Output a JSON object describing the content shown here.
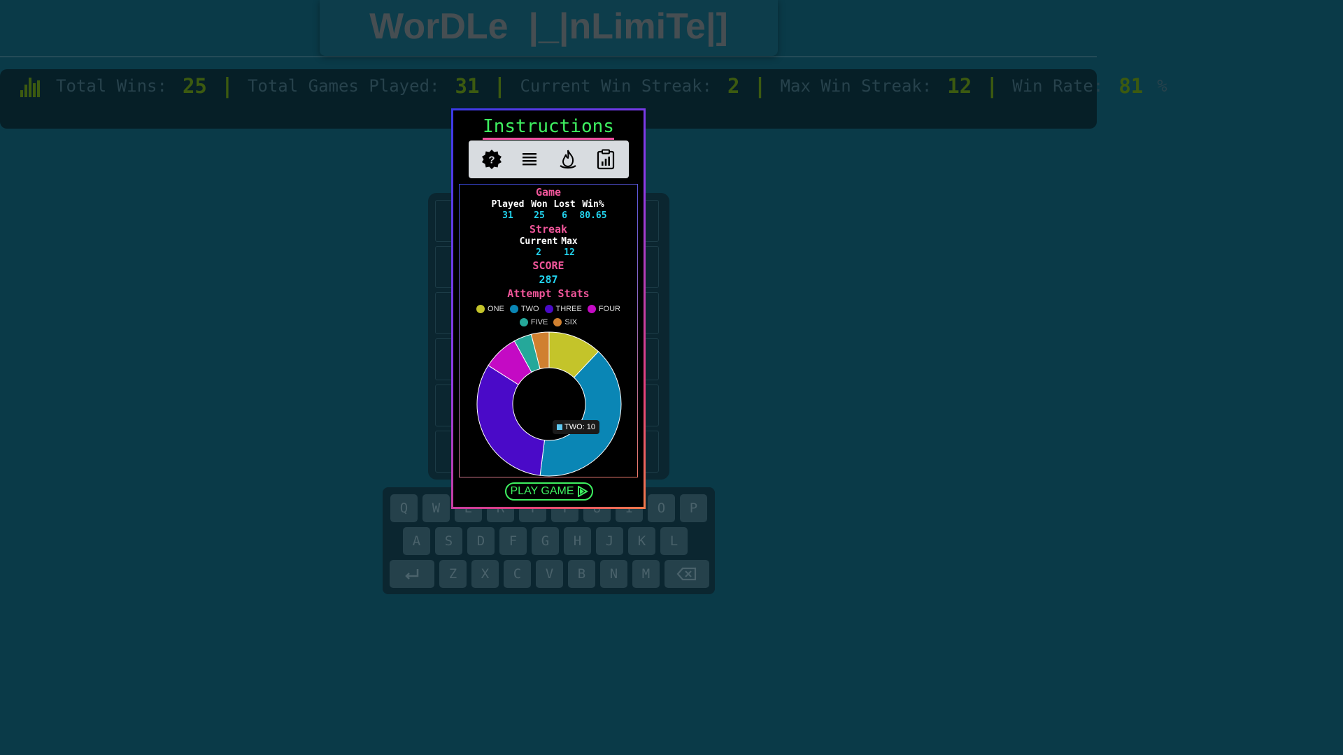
{
  "header": {
    "title": "WorDLe  |_|nLimiTe|]"
  },
  "stats_bar": {
    "icon": "bar-chart-icon",
    "total_wins_label": "Total Wins:",
    "total_wins": "25",
    "games_played_label": "Total Games Played:",
    "games_played": "31",
    "current_streak_label": "Current Win Streak:",
    "current_streak": "2",
    "max_streak_label": "Max Win Streak:",
    "max_streak": "12",
    "win_rate_label": "Win Rate:",
    "win_rate": "81",
    "win_rate_unit": "%",
    "separator": "|"
  },
  "keyboard": {
    "row1": [
      "Q",
      "W",
      "E",
      "R",
      "T",
      "Y",
      "U",
      "I",
      "O",
      "P"
    ],
    "row2": [
      "A",
      "S",
      "D",
      "F",
      "G",
      "H",
      "J",
      "K",
      "L"
    ],
    "row3": [
      "Z",
      "X",
      "C",
      "V",
      "B",
      "N",
      "M"
    ],
    "enter_icon": "enter-icon",
    "backspace_icon": "backspace-icon"
  },
  "modal": {
    "title": "Instructions",
    "tabs": [
      "help-icon",
      "list-icon",
      "flame-icon",
      "clipboard-chart-icon"
    ],
    "game_heading": "Game",
    "game_headers": [
      "Played",
      "Won",
      "Lost",
      "Win%"
    ],
    "game_values": [
      "31",
      "25",
      "6",
      "80.65"
    ],
    "streak_heading": "Streak",
    "streak_headers": [
      "Current",
      "Max"
    ],
    "streak_values": [
      "2",
      "12"
    ],
    "score_heading": "SCORE",
    "score_value": "287",
    "attempt_heading": "Attempt Stats",
    "play_button": "PLAY GAME",
    "tooltip": "TWO: 10"
  },
  "chart_data": {
    "type": "pie",
    "variant": "doughnut",
    "categories": [
      "ONE",
      "TWO",
      "THREE",
      "FOUR",
      "FIVE",
      "SIX"
    ],
    "values": [
      3,
      10,
      8,
      2,
      1,
      1
    ],
    "colors": [
      "#c4c42a",
      "#0a86b5",
      "#4a0ac8",
      "#c40ac4",
      "#25a89a",
      "#d08030"
    ],
    "legend": "top"
  }
}
